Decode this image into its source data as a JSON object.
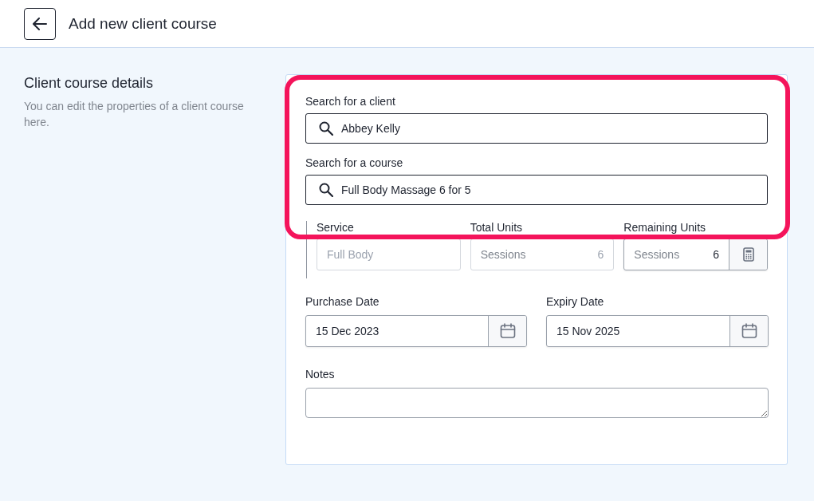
{
  "header": {
    "title": "Add new client course"
  },
  "section": {
    "title": "Client course details",
    "description": "You can edit the properties of a client course here."
  },
  "search_fields": [
    {
      "label": "Search for a client",
      "value": "Abbey Kelly"
    },
    {
      "label": "Search for a course",
      "value": "Full Body Massage 6 for 5"
    }
  ],
  "unit_fields": [
    {
      "kind": "text",
      "label": "Service",
      "value": "Full Body",
      "disabled": true
    },
    {
      "kind": "units",
      "label": "Total Units",
      "unit": "Sessions",
      "value": "6",
      "disabled": true
    },
    {
      "kind": "units-calc",
      "label": "Remaining Units",
      "unit": "Sessions",
      "value": "6",
      "disabled": false
    }
  ],
  "date_fields": [
    {
      "label": "Purchase Date",
      "value": "15 Dec 2023"
    },
    {
      "label": "Expiry Date",
      "value": "15 Nov 2025"
    }
  ],
  "notes": {
    "label": "Notes"
  }
}
